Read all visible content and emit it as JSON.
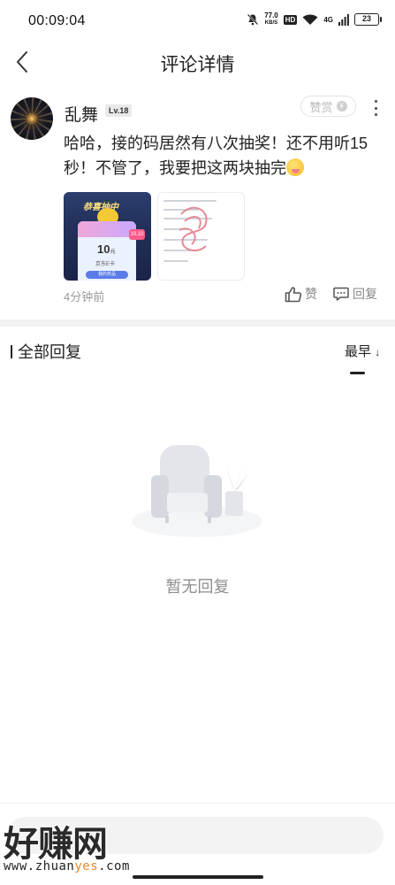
{
  "status_bar": {
    "time": "00:09:04",
    "speed_value": "77.0",
    "speed_unit": "KB/S",
    "hd": "HD",
    "network": "4G",
    "battery": "23"
  },
  "header": {
    "title": "评论详情",
    "back_icon": "chevron-left-icon"
  },
  "comment": {
    "user_name": "乱舞",
    "level": "Lv.18",
    "tip_label": "赞赏",
    "text": "哈哈，接的码居然有八次抽奖！还不用听15秒！不管了，我要把这两块抽完",
    "emoji": "face-with-tongue-emoji",
    "images": [
      {
        "banner": "恭喜抽中",
        "amount": "10",
        "unit": "元",
        "label": "京东E卡",
        "button": "我的奖品",
        "side": "10.10"
      },
      {
        "type": "document-screenshot"
      }
    ],
    "time_ago": "4分钟前",
    "like_label": "赞",
    "reply_label": "回复"
  },
  "replies": {
    "section_title": "全部回复",
    "sort_label": "最早",
    "sort_arrow": "↓",
    "empty_text": "暂无回复"
  },
  "reply_bar": {
    "placeholder": ""
  },
  "watermark": {
    "brand": "好赚网",
    "url_prefix": "www.zhuan",
    "url_highlight": "yes",
    "url_suffix": ".com"
  },
  "colors": {
    "accent": "#222222",
    "muted": "#9a9a9a",
    "divider": "#f2f2f2"
  }
}
